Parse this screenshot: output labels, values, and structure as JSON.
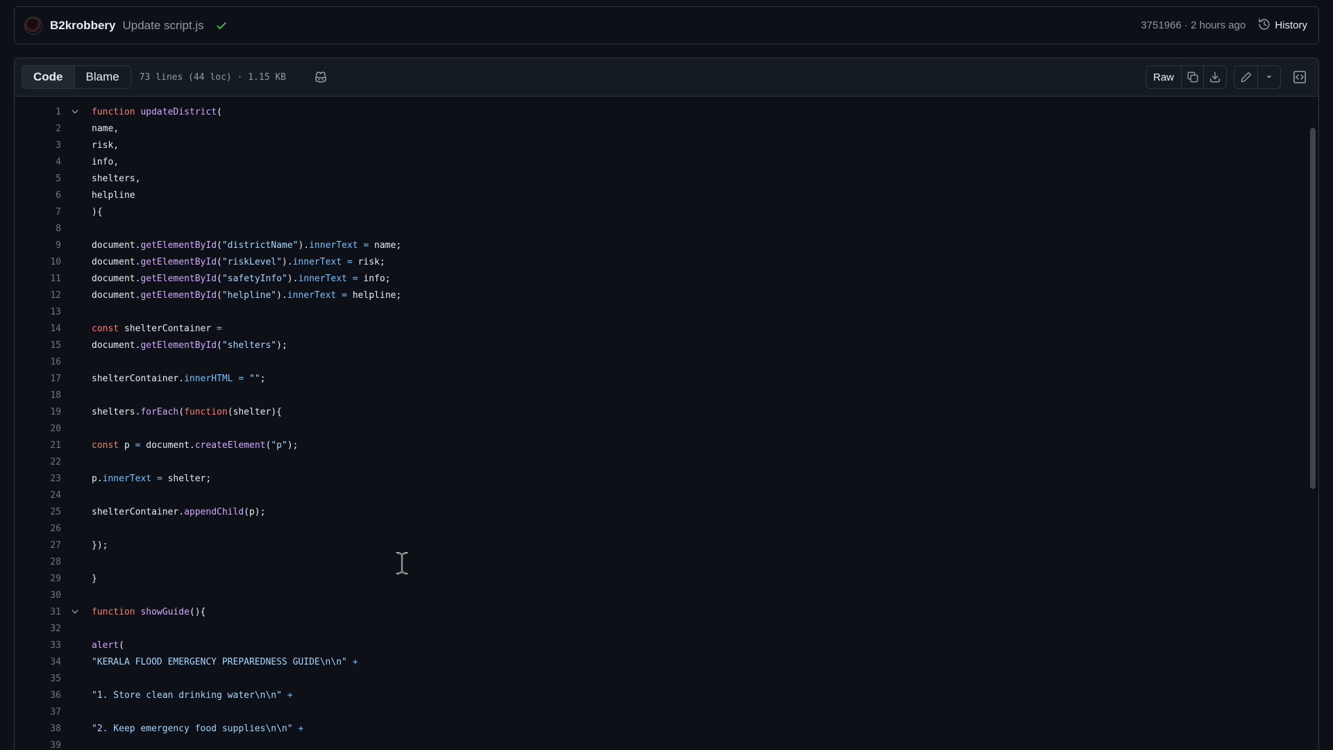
{
  "commit": {
    "author": "B2krobbery",
    "message": "Update script.js",
    "sha": "3751966",
    "separator": "·",
    "time": "2 hours ago",
    "history_label": "History",
    "status": "success"
  },
  "file_header": {
    "tabs": [
      {
        "label": "Code",
        "active": true
      },
      {
        "label": "Blame",
        "active": false
      }
    ],
    "info": "73 lines (44 loc) · 1.15 KB",
    "raw_label": "Raw"
  },
  "colors": {
    "background": "#0d1117",
    "keyword": "#ff7b72",
    "function": "#d2a8ff",
    "property": "#79c0ff",
    "string": "#a5d6ff",
    "check": "#3fb950"
  },
  "code_lines": [
    {
      "n": "1",
      "fold": true,
      "tokens": [
        {
          "t": "function",
          "c": "kw"
        },
        {
          "t": " "
        },
        {
          "t": "updateDistrict",
          "c": "fn"
        },
        {
          "t": "("
        }
      ]
    },
    {
      "n": "2",
      "tokens": [
        {
          "t": "name,"
        }
      ]
    },
    {
      "n": "3",
      "tokens": [
        {
          "t": "risk,"
        }
      ]
    },
    {
      "n": "4",
      "tokens": [
        {
          "t": "info,"
        }
      ]
    },
    {
      "n": "5",
      "tokens": [
        {
          "t": "shelters,"
        }
      ]
    },
    {
      "n": "6",
      "tokens": [
        {
          "t": "helpline"
        }
      ]
    },
    {
      "n": "7",
      "tokens": [
        {
          "t": "){"
        }
      ]
    },
    {
      "n": "8",
      "tokens": []
    },
    {
      "n": "9",
      "tokens": [
        {
          "t": "document."
        },
        {
          "t": "getElementById",
          "c": "fn"
        },
        {
          "t": "("
        },
        {
          "t": "\"districtName\"",
          "c": "str"
        },
        {
          "t": ")."
        },
        {
          "t": "innerText",
          "c": "prop"
        },
        {
          "t": " "
        },
        {
          "t": "=",
          "c": "op"
        },
        {
          "t": " name;"
        }
      ]
    },
    {
      "n": "10",
      "tokens": [
        {
          "t": "document."
        },
        {
          "t": "getElementById",
          "c": "fn"
        },
        {
          "t": "("
        },
        {
          "t": "\"riskLevel\"",
          "c": "str"
        },
        {
          "t": ")."
        },
        {
          "t": "innerText",
          "c": "prop"
        },
        {
          "t": " "
        },
        {
          "t": "=",
          "c": "op"
        },
        {
          "t": " risk;"
        }
      ]
    },
    {
      "n": "11",
      "tokens": [
        {
          "t": "document."
        },
        {
          "t": "getElementById",
          "c": "fn"
        },
        {
          "t": "("
        },
        {
          "t": "\"safetyInfo\"",
          "c": "str"
        },
        {
          "t": ")."
        },
        {
          "t": "innerText",
          "c": "prop"
        },
        {
          "t": " "
        },
        {
          "t": "=",
          "c": "op"
        },
        {
          "t": " info;"
        }
      ]
    },
    {
      "n": "12",
      "tokens": [
        {
          "t": "document."
        },
        {
          "t": "getElementById",
          "c": "fn"
        },
        {
          "t": "("
        },
        {
          "t": "\"helpline\"",
          "c": "str"
        },
        {
          "t": ")."
        },
        {
          "t": "innerText",
          "c": "prop"
        },
        {
          "t": " "
        },
        {
          "t": "=",
          "c": "op"
        },
        {
          "t": " helpline;"
        }
      ]
    },
    {
      "n": "13",
      "tokens": []
    },
    {
      "n": "14",
      "tokens": [
        {
          "t": "const",
          "c": "kw"
        },
        {
          "t": " shelterContainer "
        },
        {
          "t": "=",
          "c": "op"
        }
      ]
    },
    {
      "n": "15",
      "tokens": [
        {
          "t": "document."
        },
        {
          "t": "getElementById",
          "c": "fn"
        },
        {
          "t": "("
        },
        {
          "t": "\"shelters\"",
          "c": "str"
        },
        {
          "t": ");"
        }
      ]
    },
    {
      "n": "16",
      "tokens": []
    },
    {
      "n": "17",
      "tokens": [
        {
          "t": "shelterContainer."
        },
        {
          "t": "innerHTML",
          "c": "prop"
        },
        {
          "t": " "
        },
        {
          "t": "=",
          "c": "op"
        },
        {
          "t": " "
        },
        {
          "t": "\"\"",
          "c": "str"
        },
        {
          "t": ";"
        }
      ]
    },
    {
      "n": "18",
      "tokens": []
    },
    {
      "n": "19",
      "tokens": [
        {
          "t": "shelters."
        },
        {
          "t": "forEach",
          "c": "fn"
        },
        {
          "t": "("
        },
        {
          "t": "function",
          "c": "kw"
        },
        {
          "t": "(shelter){"
        }
      ]
    },
    {
      "n": "20",
      "tokens": []
    },
    {
      "n": "21",
      "tokens": [
        {
          "t": "const",
          "c": "kw"
        },
        {
          "t": " p "
        },
        {
          "t": "=",
          "c": "op"
        },
        {
          "t": " document."
        },
        {
          "t": "createElement",
          "c": "fn"
        },
        {
          "t": "("
        },
        {
          "t": "\"p\"",
          "c": "str"
        },
        {
          "t": ");"
        }
      ]
    },
    {
      "n": "22",
      "tokens": []
    },
    {
      "n": "23",
      "tokens": [
        {
          "t": "p."
        },
        {
          "t": "innerText",
          "c": "prop"
        },
        {
          "t": " "
        },
        {
          "t": "=",
          "c": "op"
        },
        {
          "t": " shelter;"
        }
      ]
    },
    {
      "n": "24",
      "tokens": []
    },
    {
      "n": "25",
      "tokens": [
        {
          "t": "shelterContainer."
        },
        {
          "t": "appendChild",
          "c": "fn"
        },
        {
          "t": "(p);"
        }
      ]
    },
    {
      "n": "26",
      "tokens": []
    },
    {
      "n": "27",
      "tokens": [
        {
          "t": "});"
        }
      ]
    },
    {
      "n": "28",
      "tokens": []
    },
    {
      "n": "29",
      "tokens": [
        {
          "t": "}"
        }
      ]
    },
    {
      "n": "30",
      "tokens": []
    },
    {
      "n": "31",
      "fold": true,
      "tokens": [
        {
          "t": "function",
          "c": "kw"
        },
        {
          "t": " "
        },
        {
          "t": "showGuide",
          "c": "fn"
        },
        {
          "t": "(){"
        }
      ]
    },
    {
      "n": "32",
      "tokens": []
    },
    {
      "n": "33",
      "tokens": [
        {
          "t": "alert",
          "c": "fn"
        },
        {
          "t": "("
        }
      ]
    },
    {
      "n": "34",
      "tokens": [
        {
          "t": "\"KERALA FLOOD EMERGENCY PREPAREDNESS GUIDE\\n\\n\"",
          "c": "str"
        },
        {
          "t": " "
        },
        {
          "t": "+",
          "c": "op"
        }
      ]
    },
    {
      "n": "35",
      "tokens": []
    },
    {
      "n": "36",
      "tokens": [
        {
          "t": "\"1. Store clean drinking water\\n\\n\"",
          "c": "str"
        },
        {
          "t": " "
        },
        {
          "t": "+",
          "c": "op"
        }
      ]
    },
    {
      "n": "37",
      "tokens": []
    },
    {
      "n": "38",
      "tokens": [
        {
          "t": "\"2. Keep emergency food supplies\\n\\n\"",
          "c": "str"
        },
        {
          "t": " "
        },
        {
          "t": "+",
          "c": "op"
        }
      ]
    },
    {
      "n": "39",
      "tokens": []
    }
  ]
}
